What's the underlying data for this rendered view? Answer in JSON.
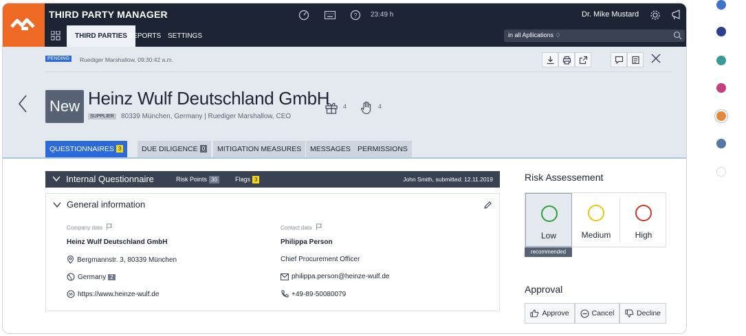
{
  "app": {
    "title": "THIRD PARTY MANAGER",
    "time": "23:49 h",
    "user": "Dr. Mike Mustard"
  },
  "nav": {
    "tabs": [
      "THIRD PARTIES",
      "REPORTS",
      "SETTINGS"
    ]
  },
  "search": {
    "scope": "in all Apllications ♢"
  },
  "status": {
    "badge": "PENDING",
    "text": "Ruediger Marshallow, 09:30:42 a.m."
  },
  "entity": {
    "state": "New",
    "name": "Heinz Wulf Deutschland GmbH",
    "type_badge": "SUPPLIER",
    "subtitle": "80339 München, Germany | Ruediger Marshallow, CEO",
    "gift_count": "4",
    "hand_count": "4"
  },
  "subtabs": [
    {
      "label": "QUESTIONNAIRES",
      "badge": "3"
    },
    {
      "label": "DUE DILIGENCE",
      "badge": "0"
    },
    {
      "label": "MITIGATION MEASURES"
    },
    {
      "label": "MESSAGES"
    },
    {
      "label": "PERMISSIONS"
    }
  ],
  "questionnaire": {
    "title": "Internal Questionnaire",
    "risk_points_label": "Risk Points",
    "risk_points": "30",
    "flags_label": "Flags",
    "flags": "3",
    "meta": "John Smith, submitted: 12.11.2019"
  },
  "general": {
    "title": "General information",
    "company": {
      "label": "Company data",
      "name": "Heinz Wulf Deutschland GmbH",
      "address": "Bergmannstr. 3, 80339 München",
      "country": "Germany",
      "country_badge": "2",
      "website": "https://www.heinze-wulf.de"
    },
    "contact": {
      "label": "Contact data",
      "name": "Philippa Person",
      "role": "Chief Procurement Officer",
      "email": "philippa.person@heinze-wulf.de",
      "phone": "+49-89-50080079"
    }
  },
  "risk": {
    "title": "Risk Assessement",
    "options": [
      {
        "label": "Low",
        "color": "#2e9e3e"
      },
      {
        "label": "Medium",
        "color": "#e8c80c"
      },
      {
        "label": "High",
        "color": "#c2372e"
      }
    ],
    "recommended": "recommended",
    "selected": "Low"
  },
  "approval": {
    "title": "Approval",
    "approve": "Approve",
    "cancel": "Cancel",
    "decline": "Decline"
  },
  "colors": {
    "dots": [
      "#3f74c7",
      "#2e3e8f",
      "#3b9999",
      "#c5407e",
      "#e18a3e",
      "#5578a4",
      "#ffffff"
    ]
  }
}
